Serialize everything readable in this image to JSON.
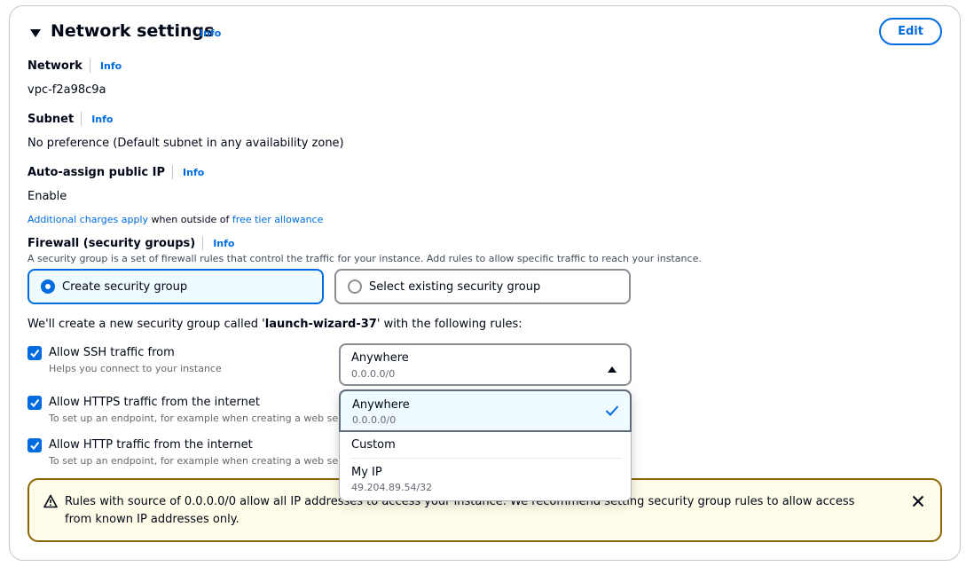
{
  "section": {
    "title": "Network settings",
    "info": "Info",
    "edit_label": "Edit"
  },
  "network": {
    "label": "Network",
    "info": "Info",
    "value": "vpc-f2a98c9a"
  },
  "subnet": {
    "label": "Subnet",
    "info": "Info",
    "value": "No preference (Default subnet in any availability zone)"
  },
  "auto_ip": {
    "label": "Auto-assign public IP",
    "info": "Info",
    "value": "Enable",
    "note_link1": "Additional charges apply",
    "note_mid": " when outside of ",
    "note_link2": "free tier allowance"
  },
  "firewall": {
    "label": "Firewall (security groups)",
    "info": "Info",
    "description": "A security group is a set of firewall rules that control the traffic for your instance. Add rules to allow specific traffic to reach your instance.",
    "options": [
      "Create security group",
      "Select existing security group"
    ],
    "selected_option": "Create security group",
    "new_group_prefix": "We'll create a new security group called '",
    "new_group_name": "launch-wizard-37",
    "new_group_suffix": "' with the following rules:"
  },
  "rules": [
    {
      "label": "Allow SSH traffic from",
      "description": "Helps you connect to your instance",
      "checked": true
    },
    {
      "label": "Allow HTTPS traffic from the internet",
      "description": "To set up an endpoint, for example when creating a web server",
      "checked": true
    },
    {
      "label": "Allow HTTP traffic from the internet",
      "description": "To set up an endpoint, for example when creating a web server",
      "checked": true
    }
  ],
  "ssh_source_select": {
    "value": "Anywhere",
    "sub": "0.0.0.0/0",
    "options": [
      {
        "label": "Anywhere",
        "sub": "0.0.0.0/0",
        "selected": true
      },
      {
        "label": "Custom",
        "sub": ""
      },
      {
        "label": "My IP",
        "sub": "49.204.89.54/32"
      }
    ]
  },
  "warning": {
    "text": "Rules with source of 0.0.0.0/0 allow all IP addresses to access your instance. We recommend setting security group rules to allow access from known IP addresses only."
  },
  "colors": {
    "link": "#006ce0",
    "warning_border": "#8d6605",
    "warning_bg": "#fffce9",
    "selected_bg": "#f0fbff"
  },
  "icons": {
    "caret": "caret-down-icon",
    "checkbox": "check-icon",
    "warning": "warning-icon",
    "close": "close-icon",
    "select_caret": "caret-up-icon",
    "option_check": "check-icon"
  }
}
